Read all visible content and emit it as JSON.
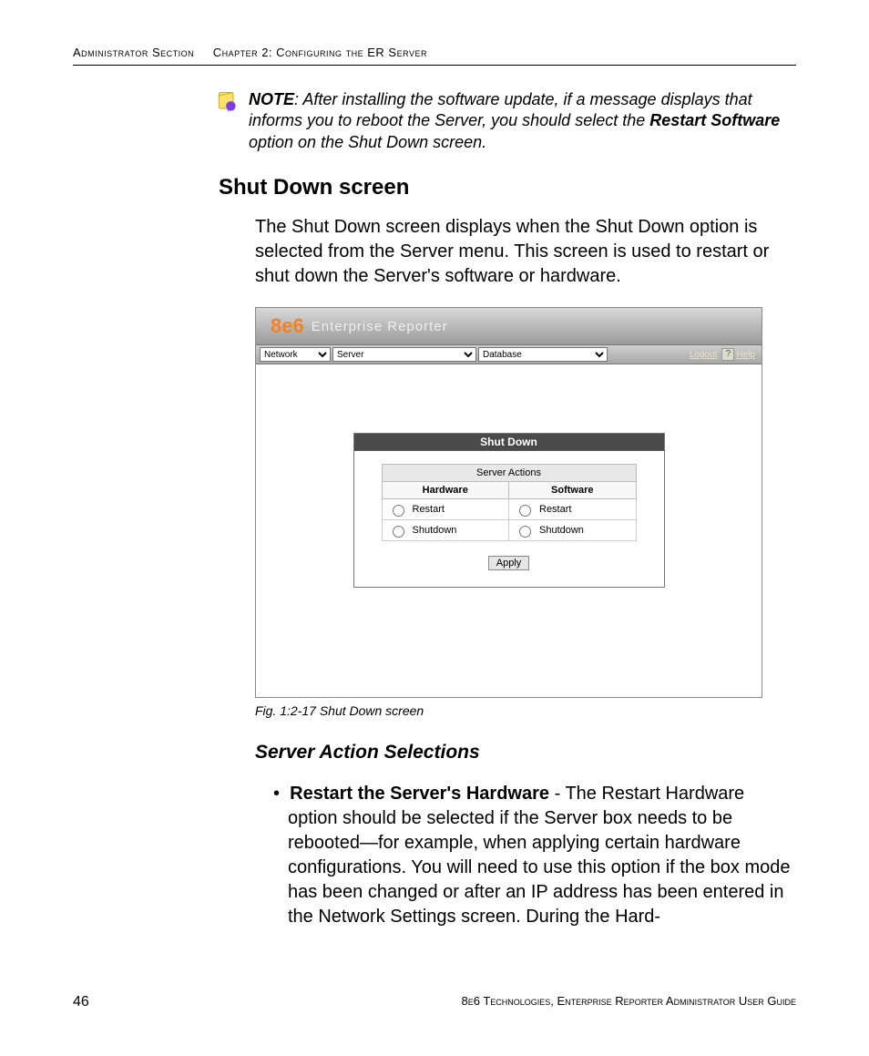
{
  "running_head": {
    "left": "Administrator Section",
    "right": "Chapter 2: Configuring the ER Server"
  },
  "note": {
    "label": "NOTE",
    "body_1": ": After installing the software update, if a message displays that informs you to reboot the Server, you should select the ",
    "bold": "Restart Software",
    "body_2": " option on the Shut Down screen."
  },
  "heading": "Shut Down screen",
  "para1": "The Shut Down screen displays when the Shut Down option is selected from the Server menu. This screen is used to restart or shut down the Server's software or hardware.",
  "figure": {
    "caption": "Fig. 1:2-17  Shut Down screen",
    "logo": "8e6",
    "app_title": "Enterprise Reporter",
    "menus": {
      "network": "Network",
      "server": "Server",
      "database": "Database"
    },
    "links": {
      "logout": "Logout",
      "help": "Help"
    },
    "panel_title": "Shut Down",
    "group_header": "Server Actions",
    "cols": {
      "hw": "Hardware",
      "sw": "Software"
    },
    "rows": {
      "hw_restart": "Restart",
      "hw_shutdown": "Shutdown",
      "sw_restart": "Restart",
      "sw_shutdown": "Shutdown"
    },
    "apply": "Apply"
  },
  "subheading": "Server Action Selections",
  "bullet1": {
    "bold": "Restart the Server's Hardware",
    "rest": " - The Restart Hardware option should be selected if the Server box needs to be rebooted—for example, when applying certain hardware configurations. You will need to use this option if the box mode has been changed or after an IP address has been entered in the Network Settings screen. During the Hard-"
  },
  "footer": {
    "page": "46",
    "text": "8e6 Technologies, Enterprise Reporter Administrator User Guide"
  }
}
